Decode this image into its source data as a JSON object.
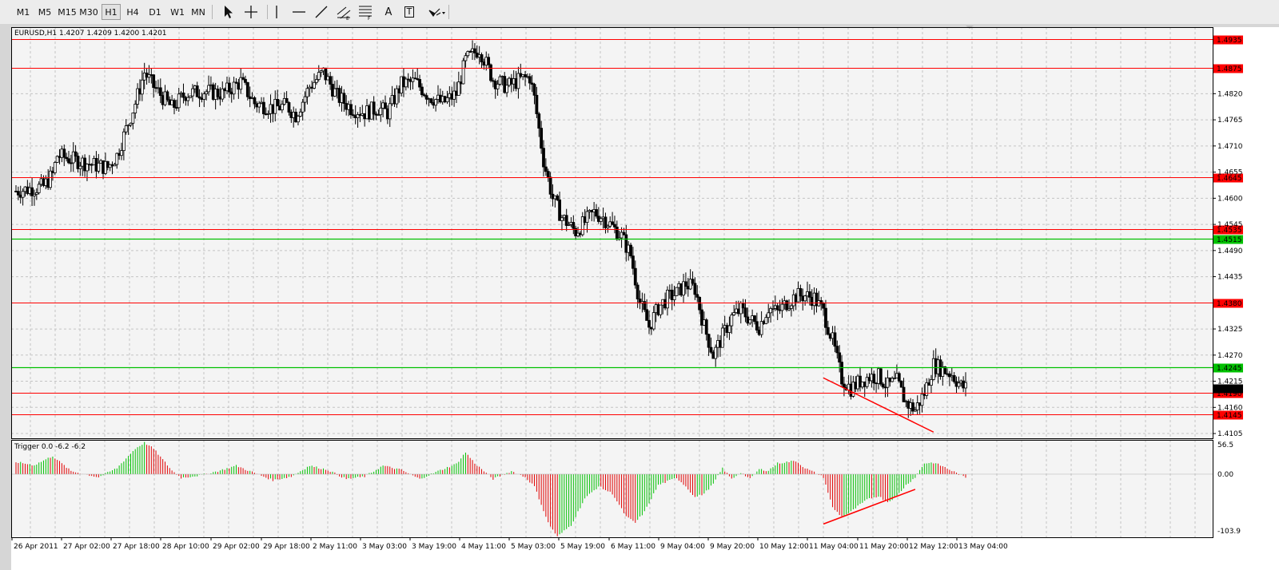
{
  "toolbar": {
    "timeframes": [
      "M1",
      "M5",
      "M15",
      "M30",
      "H1",
      "H4",
      "D1",
      "W1",
      "MN"
    ],
    "active_timeframe": "H1",
    "tools": [
      {
        "name": "cursor-icon"
      },
      {
        "name": "crosshair-icon"
      },
      {
        "name": "vertical-line-icon"
      },
      {
        "name": "horizontal-line-icon"
      },
      {
        "name": "trendline-icon"
      },
      {
        "name": "equidistant-channel-icon"
      },
      {
        "name": "fibonacci-retracement-icon"
      },
      {
        "name": "text-icon",
        "label": "A"
      },
      {
        "name": "text-label-icon",
        "label": "T"
      },
      {
        "name": "arrow-objects-dropdown-icon"
      }
    ]
  },
  "main_chart": {
    "symbol_info": "EURUSD,H1  1.4207 1.4209 1.4200 1.4201",
    "current_price": "1.4201",
    "price_range": [
      1.4095,
      1.496
    ],
    "price_ticks": [
      "1.4820",
      "1.4765",
      "1.4710",
      "1.4655",
      "1.4600",
      "1.4545",
      "1.4490",
      "1.4435",
      "1.4325",
      "1.4270",
      "1.4215",
      "1.4160",
      "1.4105"
    ],
    "levels": [
      {
        "price": 1.4935,
        "label": "1.4935",
        "color": "#ff0000"
      },
      {
        "price": 1.4875,
        "label": "1.4875",
        "color": "#ff0000"
      },
      {
        "price": 1.4645,
        "label": "1.4645",
        "color": "#ff0000"
      },
      {
        "price": 1.4535,
        "label": "1.4535",
        "color": "#ff0000"
      },
      {
        "price": 1.4515,
        "label": "1.4515",
        "color": "#00c000"
      },
      {
        "price": 1.438,
        "label": "1.4380",
        "color": "#ff0000"
      },
      {
        "price": 1.4245,
        "label": "1.4245",
        "color": "#00c000"
      },
      {
        "price": 1.419,
        "label": "1.4190",
        "color": "#ff0000"
      },
      {
        "price": 1.4145,
        "label": "1.4145",
        "color": "#ff0000"
      }
    ],
    "trendline": {
      "from": {
        "bar": 176,
        "price": 1.4222
      },
      "to": {
        "bar": 200,
        "price": 1.4108
      },
      "color": "#ff0000"
    },
    "price_path": [
      [
        0,
        1.4615
      ],
      [
        6,
        1.4625
      ],
      [
        8,
        1.465
      ],
      [
        9,
        1.469
      ],
      [
        13,
        1.468
      ],
      [
        17,
        1.467
      ],
      [
        20,
        1.4665
      ],
      [
        22,
        1.469
      ],
      [
        26,
        1.48
      ],
      [
        28,
        1.4865
      ],
      [
        30,
        1.4835
      ],
      [
        34,
        1.479
      ],
      [
        37,
        1.482
      ],
      [
        41,
        1.4825
      ],
      [
        45,
        1.482
      ],
      [
        49,
        1.4845
      ],
      [
        52,
        1.48
      ],
      [
        56,
        1.479
      ],
      [
        59,
        1.4795
      ],
      [
        61,
        1.4775
      ],
      [
        64,
        1.4835
      ],
      [
        67,
        1.4865
      ],
      [
        70,
        1.4815
      ],
      [
        73,
        1.479
      ],
      [
        76,
        1.478
      ],
      [
        79,
        1.479
      ],
      [
        81,
        1.478
      ],
      [
        84,
        1.484
      ],
      [
        87,
        1.4845
      ],
      [
        90,
        1.4815
      ],
      [
        93,
        1.48
      ],
      [
        96,
        1.482
      ],
      [
        98,
        1.489
      ],
      [
        101,
        1.4915
      ],
      [
        104,
        1.485
      ],
      [
        107,
        1.4835
      ],
      [
        110,
        1.485
      ],
      [
        112,
        1.4855
      ],
      [
        113,
        1.481
      ],
      [
        115,
        1.468
      ],
      [
        117,
        1.46
      ],
      [
        119,
        1.456
      ],
      [
        122,
        1.453
      ],
      [
        124,
        1.455
      ],
      [
        126,
        1.457
      ],
      [
        128,
        1.456
      ],
      [
        130,
        1.454
      ],
      [
        132,
        1.452
      ],
      [
        134,
        1.448
      ],
      [
        136,
        1.438
      ],
      [
        138,
        1.433
      ],
      [
        140,
        1.437
      ],
      [
        142,
        1.439
      ],
      [
        144,
        1.44
      ],
      [
        146,
        1.442
      ],
      [
        148,
        1.441
      ],
      [
        150,
        1.433
      ],
      [
        152,
        1.427
      ],
      [
        154,
        1.431
      ],
      [
        156,
        1.435
      ],
      [
        158,
        1.4365
      ],
      [
        160,
        1.4345
      ],
      [
        162,
        1.433
      ],
      [
        164,
        1.437
      ],
      [
        166,
        1.436
      ],
      [
        168,
        1.438
      ],
      [
        170,
        1.4395
      ],
      [
        172,
        1.4395
      ],
      [
        174,
        1.439
      ],
      [
        176,
        1.436
      ],
      [
        178,
        1.43
      ],
      [
        180,
        1.422
      ],
      [
        182,
        1.42
      ],
      [
        184,
        1.4215
      ],
      [
        186,
        1.4225
      ],
      [
        188,
        1.4225
      ],
      [
        190,
        1.4205
      ],
      [
        192,
        1.4215
      ],
      [
        194,
        1.417
      ],
      [
        196,
        1.4155
      ],
      [
        198,
        1.419
      ],
      [
        200,
        1.425
      ],
      [
        202,
        1.424
      ],
      [
        204,
        1.423
      ],
      [
        206,
        1.4205
      ],
      [
        207,
        1.4201
      ]
    ]
  },
  "x_axis": {
    "labels": [
      "26 Apr 2011",
      "27 Apr 02:00",
      "27 Apr 18:00",
      "28 Apr 10:00",
      "29 Apr 02:00",
      "29 Apr 18:00",
      "2 May 11:00",
      "3 May 03:00",
      "3 May 19:00",
      "4 May 11:00",
      "5 May 03:00",
      "5 May 19:00",
      "6 May 11:00",
      "9 May 04:00",
      "9 May 20:00",
      "10 May 12:00",
      "11 May 04:00",
      "11 May 20:00",
      "12 May 12:00",
      "13 May 04:00"
    ]
  },
  "indicator": {
    "label": "Trigger 0.0 -6.2 -6.2",
    "scale_top": "56.5",
    "scale_zero": "0.00",
    "scale_bottom": "-103.9",
    "range": [
      -103.9,
      56.5
    ],
    "colors": {
      "positive": "#00c000",
      "negative": "#e00000"
    },
    "trendline": {
      "from": {
        "bar": 176,
        "value": -82
      },
      "to": {
        "bar": 196,
        "value": -25
      },
      "color": "#ff0000"
    },
    "value_path": [
      [
        0,
        20
      ],
      [
        4,
        15
      ],
      [
        8,
        30
      ],
      [
        12,
        5
      ],
      [
        18,
        -5
      ],
      [
        22,
        10
      ],
      [
        26,
        42
      ],
      [
        28,
        52
      ],
      [
        30,
        42
      ],
      [
        34,
        6
      ],
      [
        36,
        -6
      ],
      [
        40,
        -2
      ],
      [
        44,
        5
      ],
      [
        48,
        14
      ],
      [
        52,
        2
      ],
      [
        56,
        -10
      ],
      [
        60,
        -4
      ],
      [
        64,
        14
      ],
      [
        68,
        7
      ],
      [
        72,
        -8
      ],
      [
        76,
        -4
      ],
      [
        80,
        14
      ],
      [
        84,
        7
      ],
      [
        88,
        -8
      ],
      [
        92,
        5
      ],
      [
        96,
        17
      ],
      [
        98,
        36
      ],
      [
        100,
        18
      ],
      [
        104,
        -8
      ],
      [
        108,
        5
      ],
      [
        111,
        -5
      ],
      [
        113,
        -20
      ],
      [
        116,
        -80
      ],
      [
        118,
        -103
      ],
      [
        121,
        -84
      ],
      [
        124,
        -40
      ],
      [
        127,
        -20
      ],
      [
        130,
        -32
      ],
      [
        133,
        -70
      ],
      [
        135,
        -80
      ],
      [
        137,
        -62
      ],
      [
        140,
        -18
      ],
      [
        142,
        -12
      ],
      [
        144,
        -6
      ],
      [
        146,
        -20
      ],
      [
        148,
        -38
      ],
      [
        150,
        -32
      ],
      [
        152,
        -16
      ],
      [
        154,
        10
      ],
      [
        156,
        -8
      ],
      [
        158,
        3
      ],
      [
        160,
        -8
      ],
      [
        162,
        8
      ],
      [
        164,
        6
      ],
      [
        166,
        18
      ],
      [
        170,
        22
      ],
      [
        172,
        10
      ],
      [
        174,
        3
      ],
      [
        176,
        -5
      ],
      [
        178,
        -55
      ],
      [
        180,
        -70
      ],
      [
        182,
        -62
      ],
      [
        184,
        -50
      ],
      [
        186,
        -40
      ],
      [
        188,
        -36
      ],
      [
        190,
        -46
      ],
      [
        192,
        -36
      ],
      [
        194,
        -18
      ],
      [
        196,
        -5
      ],
      [
        198,
        18
      ],
      [
        200,
        19
      ],
      [
        202,
        13
      ],
      [
        205,
        2
      ],
      [
        207,
        -6
      ]
    ]
  },
  "colors": {
    "background": "#f4f4f4",
    "grid": "#c4c4c4",
    "frame": "#000000",
    "candle": "#000000",
    "toolbar_bg": "#ececec"
  }
}
